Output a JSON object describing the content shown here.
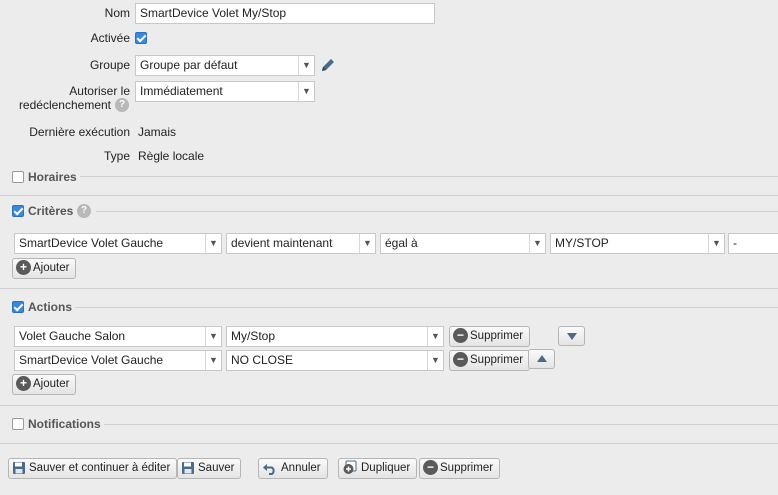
{
  "form": {
    "nom_label": "Nom",
    "nom_value": "SmartDevice Volet My/Stop",
    "activee_label": "Activée",
    "groupe_label": "Groupe",
    "groupe_value": "Groupe par défaut",
    "autoriser_label_1": "Autoriser le",
    "autoriser_label_2": "redéclenchement",
    "autoriser_value": "Immédiatement",
    "derniere_label": "Dernière exécution",
    "derniere_value": "Jamais",
    "type_label": "Type",
    "type_value": "Règle locale"
  },
  "sections": {
    "horaires": "Horaires",
    "criteres": "Critères",
    "actions": "Actions",
    "notifications": "Notifications"
  },
  "criteres": {
    "device": "SmartDevice Volet Gauche",
    "condition": "devient maintenant",
    "operator": "égal à",
    "value": "MY/STOP",
    "extra": "-",
    "add_label": "Ajouter"
  },
  "actions": {
    "rows": [
      {
        "device": "Volet Gauche Salon",
        "command": "My/Stop",
        "delete_label": "Supprimer"
      },
      {
        "device": "SmartDevice Volet Gauche",
        "command": "NO CLOSE",
        "delete_label": "Supprimer"
      }
    ],
    "add_label": "Ajouter"
  },
  "footer": {
    "save_continue": "Sauver et continuer à éditer",
    "save": "Sauver",
    "cancel": "Annuler",
    "duplicate": "Dupliquer",
    "delete": "Supprimer"
  },
  "icons": {
    "help": "?",
    "edit": "pencil-icon",
    "add": "+",
    "minus": "−"
  },
  "colors": {
    "checkbox_accent": "#3a87e0"
  }
}
